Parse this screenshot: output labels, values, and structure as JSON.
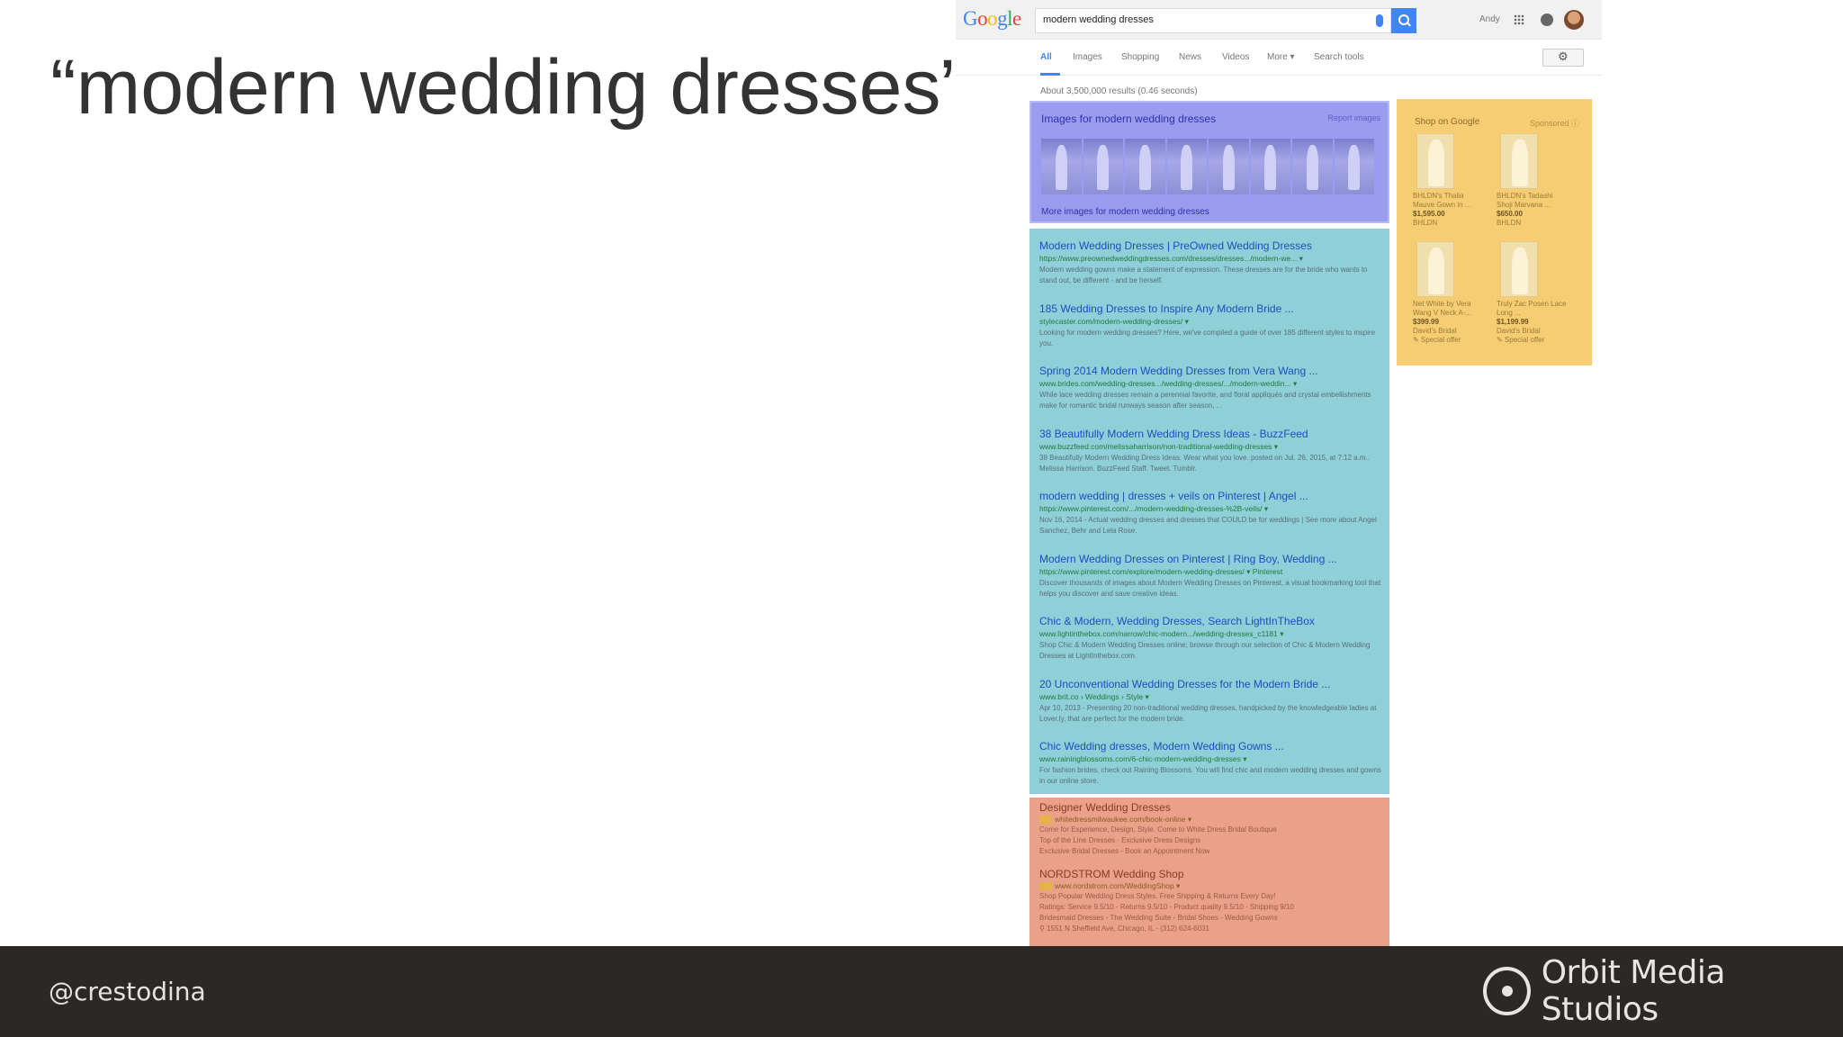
{
  "slide": {
    "title": "“modern wedding dresses”",
    "handle": "@crestodina",
    "brand": "Orbit Media Studios"
  },
  "serp": {
    "logo": "Google",
    "query": "modern wedding dresses",
    "user": "Andy",
    "tabs": [
      "All",
      "Images",
      "Shopping",
      "News",
      "Videos",
      "More ▾",
      "Search tools"
    ],
    "stats": "About 3,500,000 results (0.46 seconds)",
    "images_box": {
      "title": "Images for modern wedding dresses",
      "report": "Report images",
      "more": "More images for modern wedding dresses"
    },
    "organic": [
      {
        "title": "Modern Wedding Dresses | PreOwned Wedding Dresses",
        "url": "https://www.preownedweddingdresses.com/dresses/dresses.../modern-we... ▾",
        "snippet": "Modern wedding gowns make a statement of expression. These dresses are for the bride who wants to stand out, be different - and be herself."
      },
      {
        "title": "185 Wedding Dresses to Inspire Any Modern Bride ...",
        "url": "stylecaster.com/modern-wedding-dresses/ ▾",
        "snippet": "Looking for modern wedding dresses? Here, we've compiled a guide of over 185 different styles to inspire you."
      },
      {
        "title": "Spring 2014 Modern Wedding Dresses from Vera Wang ...",
        "url": "www.brides.com/wedding-dresses.../wedding-dresses/.../modern-weddin... ▾",
        "snippet": "While lace wedding dresses remain a perennial favorite, and floral appliqués and crystal embellishments make for romantic bridal runways season after season, ..."
      },
      {
        "title": "38 Beautifully Modern Wedding Dress Ideas - BuzzFeed",
        "url": "www.buzzfeed.com/melissaharrison/non-traditional-wedding-dresses ▾",
        "snippet": "38 Beautifully Modern Wedding Dress Ideas. Wear what you love. posted on Jul. 26, 2015, at 7:12 a.m.. Melissa Harrison. BuzzFeed Staff. Tweet. Tumblr."
      },
      {
        "title": "modern wedding | dresses + veils on Pinterest | Angel ...",
        "url": "https://www.pinterest.com/.../modern-wedding-dresses-%2B-veils/ ▾",
        "snippet": "Nov 16, 2014 - Actual wedding dresses and dresses that COULD be for weddings | See more about Angel Sanchez, Behr and Lela Rose."
      },
      {
        "title": "Modern Wedding Dresses on Pinterest | Ring Boy, Wedding ...",
        "url": "https://www.pinterest.com/explore/modern-wedding-dresses/ ▾ Pinterest",
        "snippet": "Discover thousands of images about Modern Wedding Dresses on Pinterest, a visual bookmarking tool that helps you discover and save creative ideas."
      },
      {
        "title": "Chic & Modern, Wedding Dresses, Search LightInTheBox",
        "url": "www.lightinthebox.com/narrow/chic-modern.../wedding-dresses_c1181 ▾",
        "snippet": "Shop Chic & Modern Wedding Dresses online; browse through our selection of Chic & Modern Wedding Dresses at LightInthebox.com."
      },
      {
        "title": "20 Unconventional Wedding Dresses for the Modern Bride ...",
        "url": "www.brit.co › Weddings › Style ▾",
        "snippet": "Apr 10, 2013 - Presenting 20 non-traditional wedding dresses, handpicked by the knowledgeable ladies at Lover.ly, that are perfect for the modern bride."
      },
      {
        "title": "Chic Wedding dresses, Modern Wedding Gowns ...",
        "url": "www.rainingblossoms.com/6-chic-modern-wedding-dresses ▾",
        "snippet": "For fashion brides, check out Raining Blossoms. You will find chic and modern wedding dresses and gowns in our online store."
      }
    ],
    "shopping": {
      "title": "Shop on Google",
      "sponsored": "Sponsored ⓘ",
      "products": [
        {
          "name": "BHLDN's Thalia Mauve Gown in ...",
          "price": "$1,595.00",
          "store": "BHLDN",
          "extra": ""
        },
        {
          "name": "BHLDN's Tadashi Shoji Marvana ...",
          "price": "$650.00",
          "store": "BHLDN",
          "extra": ""
        },
        {
          "name": "Net White by Vera Wang V Neck A-...",
          "price": "$399.99",
          "store": "David's Bridal",
          "extra": "✎ Special offer"
        },
        {
          "name": "Truly Zac Posen Lace Long ...",
          "price": "$1,199.99",
          "store": "David's Bridal",
          "extra": "✎ Special offer"
        }
      ]
    },
    "ads": [
      {
        "title": "Designer Wedding Dresses",
        "url": "whitedressmilwaukee.com/book-online ▾",
        "lines": [
          "Come for Experience, Design, Style. Come to White Dress Bridal Boutique",
          "Top of the Line Dresses · Exclusive Dress Designs",
          "Exclusive Bridal Dresses - Book an Appointment Now"
        ]
      },
      {
        "title": "NORDSTROM Wedding Shop",
        "url": "www.nordstrom.com/WeddingShop ▾",
        "lines": [
          "Shop Popular Wedding Dress Styles. Free Shipping & Returns Every Day!",
          "Ratings: Service 9.5/10 - Returns 9.5/10 - Product quality 9.5/10 - Shipping 9/10",
          "Bridesmaid Dresses - The Wedding Suite - Bridal Shoes - Wedding Gowns",
          "⚲ 1551 N Sheffield Ave, Chicago, IL - (312) 624-6031"
        ]
      }
    ]
  },
  "colors": {
    "images_highlight": "#9b9cf0",
    "organic_highlight": "#8ecfd8",
    "shopping_highlight": "#f7cd73",
    "ads_highlight": "#e9a18a",
    "footer": "#2c2826"
  }
}
